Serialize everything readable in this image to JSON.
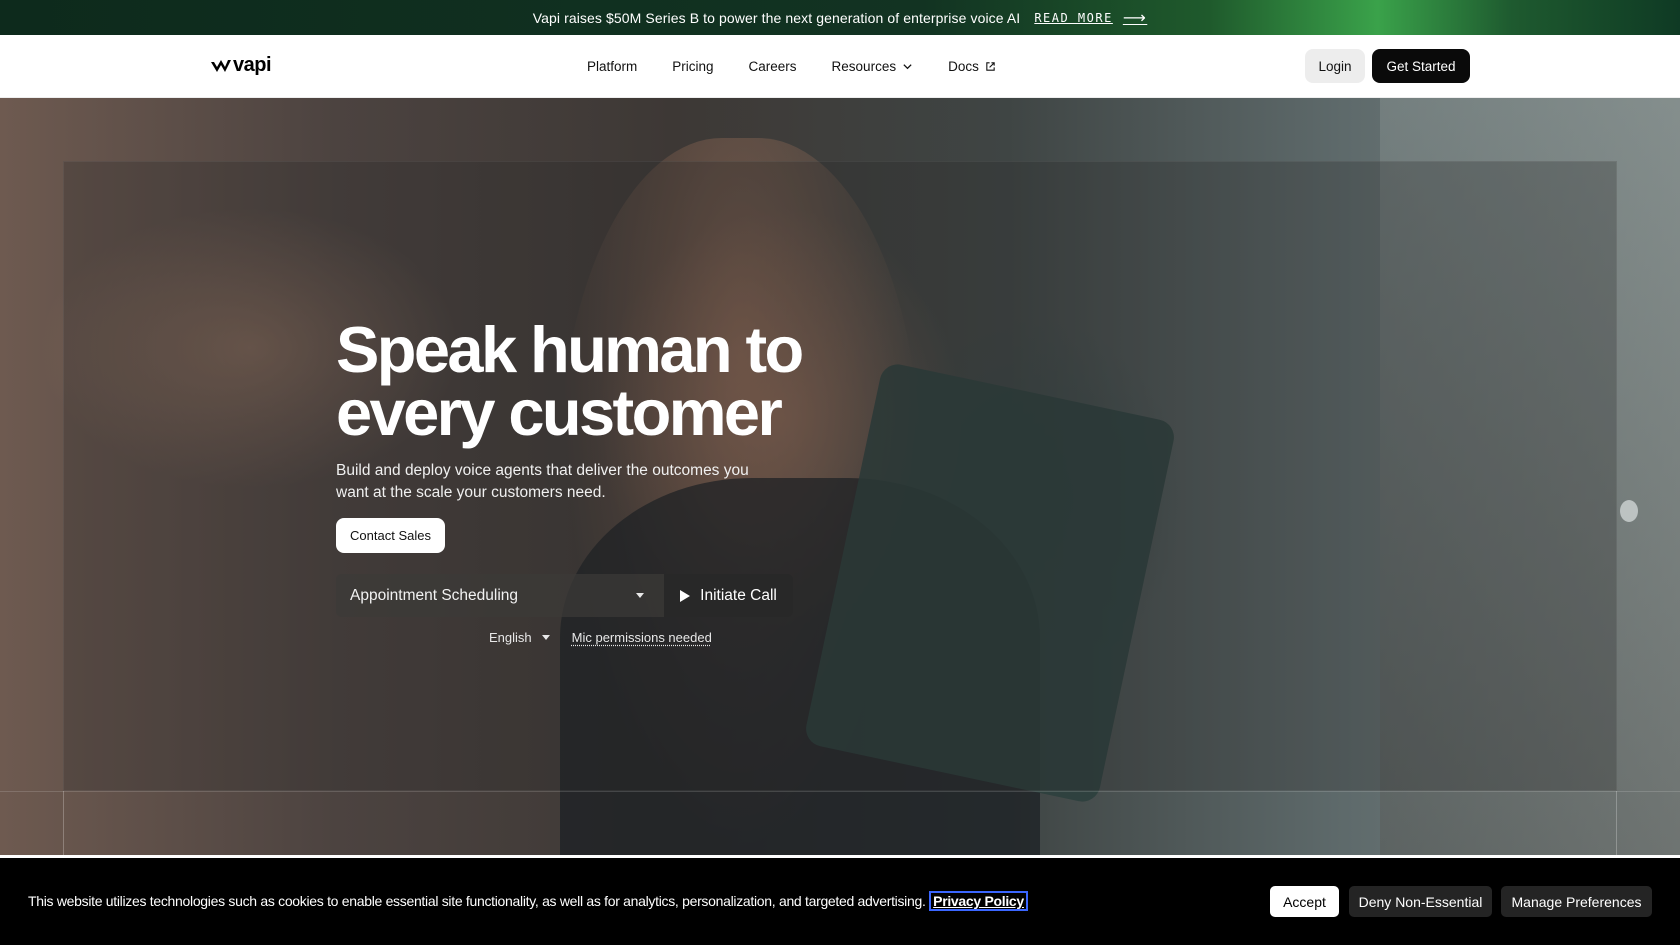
{
  "announcement": {
    "text": "Vapi raises $50M Series B to power the next generation of enterprise voice AI",
    "link_label": "READ MORE",
    "arrow_icon": "arrow-right-icon"
  },
  "header": {
    "logo_text": "vapi",
    "nav": [
      {
        "label": "Platform"
      },
      {
        "label": "Pricing"
      },
      {
        "label": "Careers"
      },
      {
        "label": "Resources",
        "icon": "chevron-down-icon"
      },
      {
        "label": "Docs",
        "icon": "external-link-icon"
      }
    ],
    "login_label": "Login",
    "get_started_label": "Get Started"
  },
  "hero": {
    "title_line1": "Speak human to",
    "title_line2": "every customer",
    "subtitle": "Build and deploy voice agents that deliver the outcomes you want at the scale your customers need.",
    "contact_label": "Contact Sales",
    "demo": {
      "selected_use_case": "Appointment Scheduling",
      "call_label": "Initiate Call",
      "language": "English",
      "mic_notice": "Mic permissions needed"
    }
  },
  "cookie": {
    "text": "This website utilizes technologies such as cookies to enable essential site functionality, as well as for analytics, personalization, and targeted advertising.",
    "privacy_link": "Privacy Policy",
    "accept_label": "Accept",
    "deny_label": "Deny Non-Essential",
    "manage_label": "Manage Preferences"
  },
  "colors": {
    "brand_black": "#0a0a0a",
    "announcement_green": "#3aa24a",
    "link_focus": "#3a66ff"
  }
}
